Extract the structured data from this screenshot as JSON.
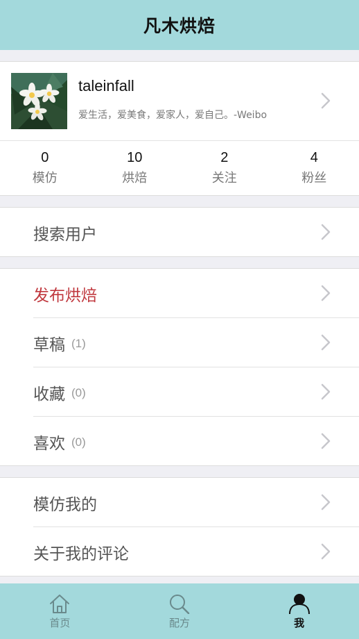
{
  "navbar": {
    "title": "凡木烘焙"
  },
  "profile": {
    "username": "taleinfall",
    "bio": "爱生活，爱美食，爱家人，爱自己。-Weibo",
    "avatar_icon": "plumeria-flower-photo"
  },
  "stats": [
    {
      "value": "0",
      "label": "模仿"
    },
    {
      "value": "10",
      "label": "烘焙"
    },
    {
      "value": "2",
      "label": "关注"
    },
    {
      "value": "4",
      "label": "粉丝"
    }
  ],
  "menu": {
    "search_user": "搜索用户",
    "publish": "发布烘焙",
    "drafts": {
      "label": "草稿",
      "count": "(1)"
    },
    "favorites": {
      "label": "收藏",
      "count": "(0)"
    },
    "likes": {
      "label": "喜欢",
      "count": "(0)"
    },
    "imitated_mine": "模仿我的",
    "comments_about_me": "关于我的评论"
  },
  "tabbar": {
    "items": [
      {
        "label": "首页",
        "icon": "home-icon"
      },
      {
        "label": "配方",
        "icon": "search-icon"
      },
      {
        "label": "我",
        "icon": "profile-icon"
      }
    ],
    "active": "我"
  },
  "colors": {
    "bar_background": "#a3d9dc",
    "accent_red": "#c0383e",
    "page_background": "#efeff4"
  }
}
